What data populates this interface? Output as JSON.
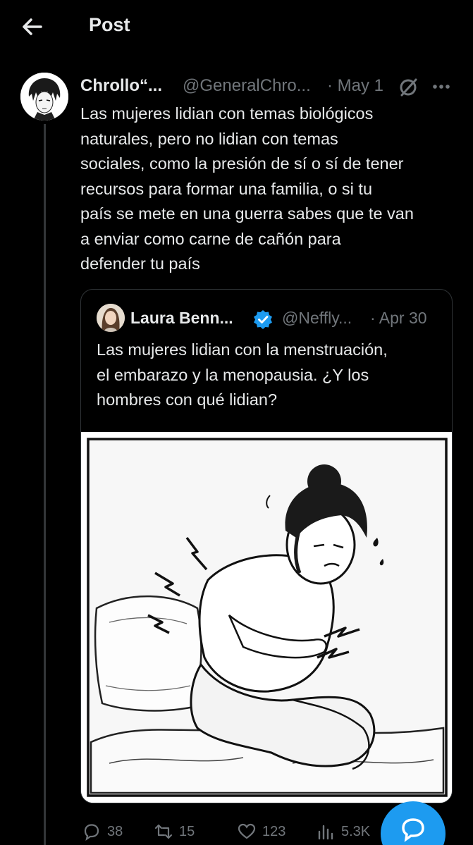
{
  "header": {
    "title": "Post"
  },
  "post": {
    "author_name": "Chrollo“...",
    "author_handle": "@GeneralChro...",
    "date": "· May 1",
    "text": "Las mujeres lidian con temas biológicos\nnaturales, pero no lidian con temas\nsociales, como la presión de sí o sí de tener\nrecursos para formar una familia, o si tu\npaís se mete en una guerra sabes que te van\na enviar como carne de cañón para\ndefender tu país"
  },
  "quote": {
    "author_name": "Laura Benn...",
    "author_handle": "@Neffly...",
    "date": "· Apr 30",
    "text": "Las mujeres lidian con la menstruación,\nel embarazo y la menopausia. ¿Y los\nhombres con qué lidian?"
  },
  "actions": {
    "replies": "38",
    "reposts": "15",
    "likes": "123",
    "views": "5.3K"
  },
  "icons": {
    "back": "arrow-left-icon",
    "grok": "grok-icon",
    "more": "more-horizontal-icon",
    "verified": "verified-badge-icon",
    "reply": "reply-icon",
    "repost": "repost-icon",
    "like": "heart-icon",
    "views": "analytics-icon",
    "compose": "compose-reply-icon"
  },
  "colors": {
    "background": "#000000",
    "text": "#e7e9ea",
    "muted": "#71767b",
    "accent": "#1d9bf0",
    "border": "#2f3336"
  }
}
